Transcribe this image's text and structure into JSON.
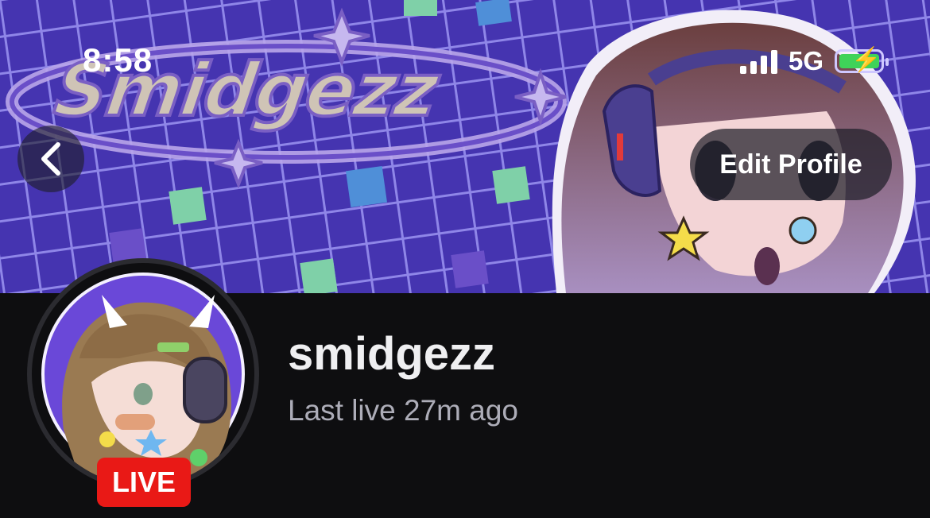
{
  "status_bar": {
    "time": "8:58",
    "network": "5G",
    "signal_bars": 4,
    "battery_charging": true
  },
  "banner": {
    "logo_text": "Smidgezz"
  },
  "header": {
    "back_icon": "chevron-left-icon",
    "edit_profile_label": "Edit Profile"
  },
  "profile": {
    "username": "smidgezz",
    "last_live": "Last live 27m ago",
    "live_badge": "LIVE"
  },
  "colors": {
    "background": "#0e0e10",
    "live_red": "#e91916",
    "banner_purple": "#3b2e9e",
    "battery_green": "#3fd359"
  }
}
